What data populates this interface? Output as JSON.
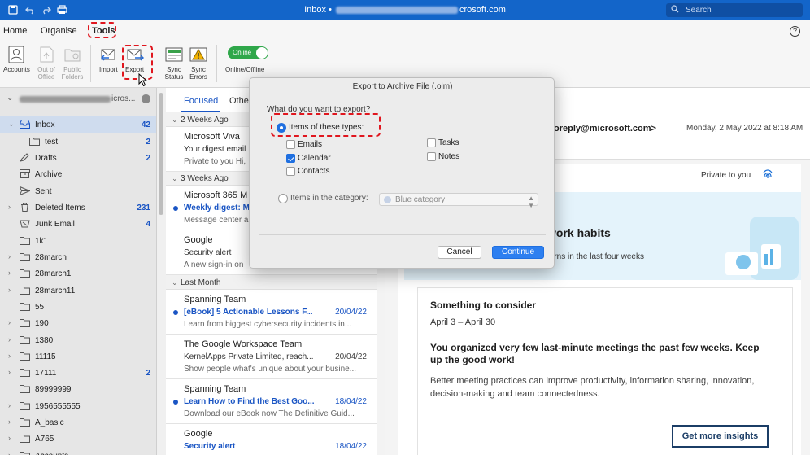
{
  "window": {
    "title_prefix": "Inbox •",
    "title_suffix": "crosoft.com",
    "search_placeholder": "Search"
  },
  "menu": {
    "tabs": [
      "Home",
      "Organise",
      "Tools"
    ],
    "active": "Tools"
  },
  "ribbon": {
    "accounts": "Accounts",
    "out_of_office": "Out of Office",
    "public_folders": "Public Folders",
    "import": "Import",
    "export": "Export",
    "sync_status": "Sync Status",
    "sync_errors": "Sync Errors",
    "toggle_state": "Online",
    "toggle_caption": "Online/Offline"
  },
  "sidebar": {
    "account_suffix": "icros...",
    "folders": [
      {
        "name": "Inbox",
        "count": "42"
      },
      {
        "name": "test",
        "count": "2"
      },
      {
        "name": "Drafts",
        "count": "2"
      },
      {
        "name": "Archive",
        "count": ""
      },
      {
        "name": "Sent",
        "count": ""
      },
      {
        "name": "Deleted Items",
        "count": "231"
      },
      {
        "name": "Junk Email",
        "count": "4"
      },
      {
        "name": "1k1",
        "count": ""
      },
      {
        "name": "28march",
        "count": ""
      },
      {
        "name": "28march1",
        "count": ""
      },
      {
        "name": "28march11",
        "count": ""
      },
      {
        "name": "55",
        "count": ""
      },
      {
        "name": "190",
        "count": ""
      },
      {
        "name": "1380",
        "count": ""
      },
      {
        "name": "11115",
        "count": ""
      },
      {
        "name": "17111",
        "count": "2"
      },
      {
        "name": "89999999",
        "count": ""
      },
      {
        "name": "1956555555",
        "count": ""
      },
      {
        "name": "A_basic",
        "count": ""
      },
      {
        "name": "A765",
        "count": ""
      },
      {
        "name": "Accounts",
        "count": ""
      }
    ]
  },
  "message_list": {
    "tab_focused": "Focused",
    "tab_other": "Othe",
    "groups": [
      "2 Weeks Ago",
      "3 Weeks Ago",
      "Last Month"
    ],
    "messages": [
      {
        "sender": "Microsoft Viva",
        "subject": "Your digest email",
        "date": "",
        "preview": "Private to you Hi,"
      },
      {
        "sender": "Microsoft 365 M",
        "subject": "Weekly digest: M",
        "date": "",
        "preview": "Message center a"
      },
      {
        "sender": "Google",
        "subject": "Security alert",
        "date": "",
        "preview": "A new sign-in on"
      },
      {
        "sender": "Spanning Team",
        "subject": "[eBook] 5 Actionable Lessons F...",
        "date": "20/04/22",
        "preview": "Learn from biggest cybersecurity incidents in..."
      },
      {
        "sender": "The Google Workspace Team",
        "subject": "KernelApps Private Limited, reach...",
        "date": "20/04/22",
        "preview": "Show people what's unique about your busine..."
      },
      {
        "sender": "Spanning Team",
        "subject": "Learn How to Find the Best Goo...",
        "date": "18/04/22",
        "preview": "Download our eBook now The Definitive Guid..."
      },
      {
        "sender": "Google",
        "subject": "Security alert",
        "date": "18/04/22",
        "preview": ""
      }
    ]
  },
  "reading_pane": {
    "from": "oreply@microsoft.com>",
    "date": "Monday, 2 May 2022 at 8:18 AM",
    "private": "Private to you",
    "banner_title": "work habits",
    "banner_sub": "terns in the last four weeks",
    "card_heading": "Something to consider",
    "card_dates": "April 3 – April 30",
    "card_bold": "You organized very few last-minute meetings the past few weeks. Keep up the good work!",
    "card_para": "Better meeting practices can improve productivity, information sharing, innovation, decision-making and team connectedness.",
    "cta": "Get more insights"
  },
  "dialog": {
    "title": "Export to Archive File (.olm)",
    "question": "What do you want to export?",
    "option_types": "Items of these types:",
    "emails": "Emails",
    "calendar": "Calendar",
    "contacts": "Contacts",
    "tasks": "Tasks",
    "notes": "Notes",
    "option_category": "Items in the category:",
    "category_value": "Blue category",
    "cancel": "Cancel",
    "continue": "Continue",
    "calendar_checked": true
  },
  "colors": {
    "titlebar": "#1365c9",
    "accent": "#1a55c4",
    "highlight": "#e0161e",
    "toggle": "#2fa74a"
  }
}
